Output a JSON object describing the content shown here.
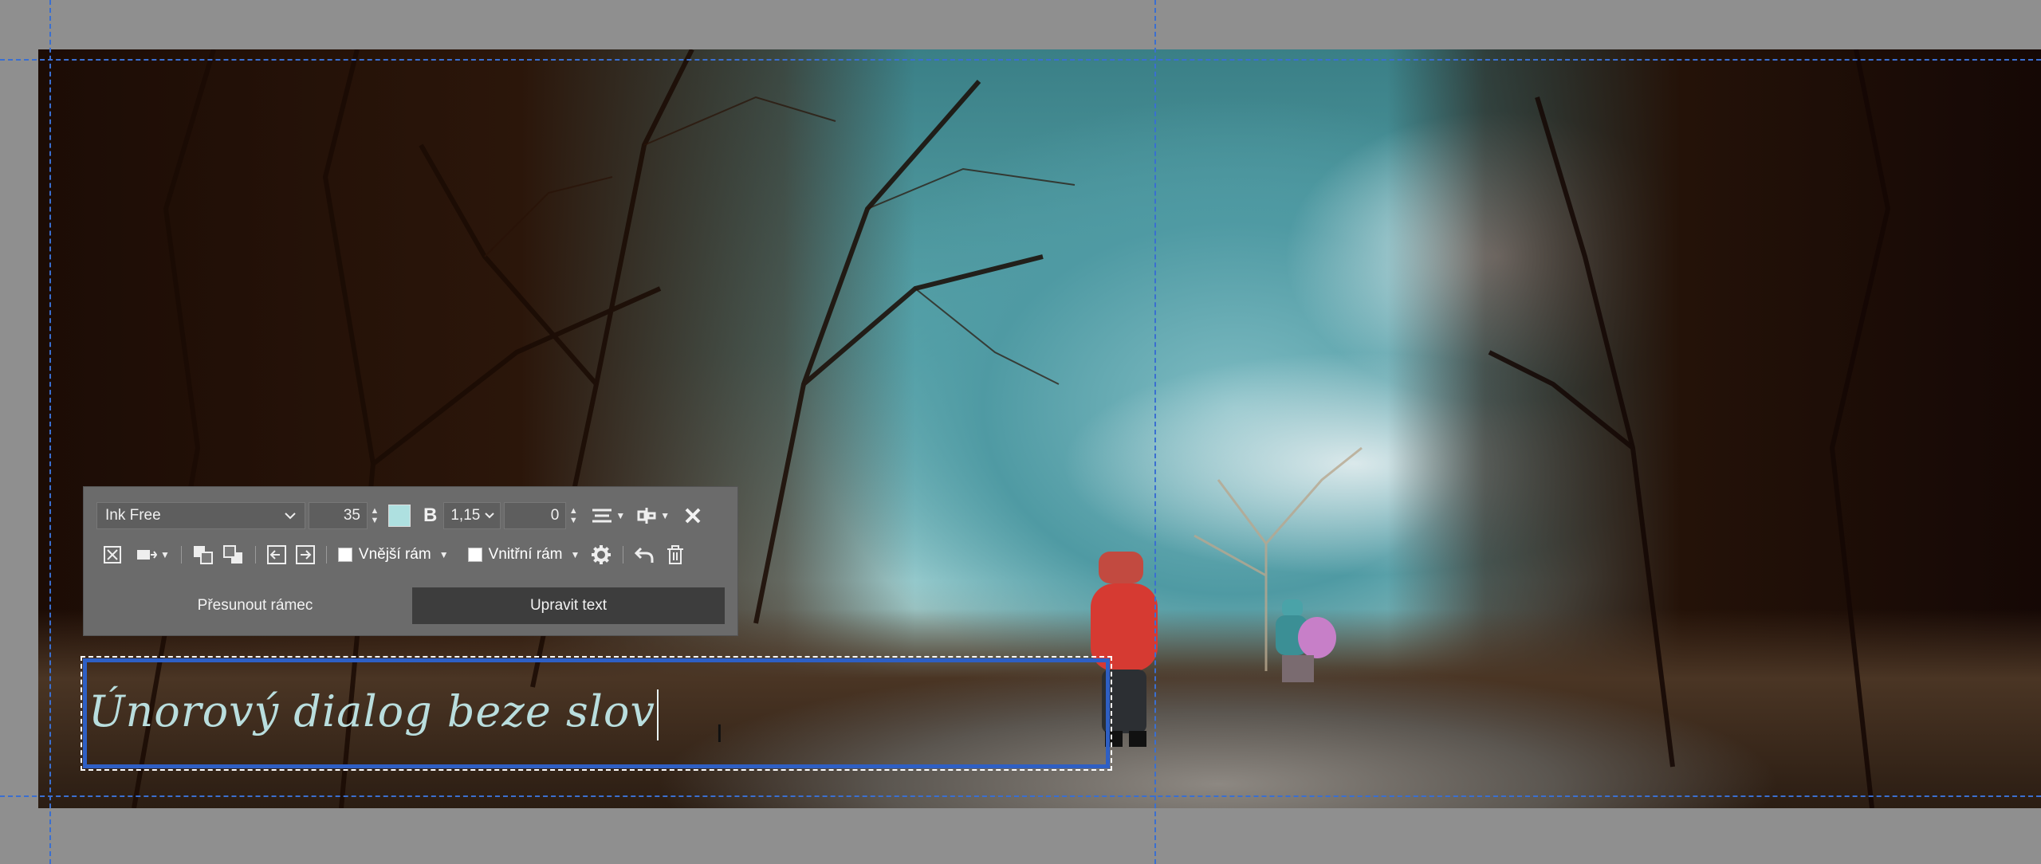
{
  "colors": {
    "guide": "#3a6fd1",
    "toolbar_bg": "#6b6b6b",
    "text_color_swatch": "#aee0e0",
    "frame_border": "#2e5fc4"
  },
  "toolbar": {
    "font_family": "Ink Free",
    "font_size": "35",
    "bold_label": "B",
    "line_spacing": "1,15",
    "letter_spacing": "0",
    "outer_frame_label": "Vnější rám",
    "inner_frame_label": "Vnitřní rám",
    "move_frame_label": "Přesunout rámec",
    "edit_text_label": "Upravit text",
    "icons": [
      "chevron-down-icon",
      "spin-up-icon",
      "spin-down-icon",
      "align-icon",
      "text-position-icon",
      "close-icon",
      "fit-frame-icon",
      "wrap-icon",
      "bring-forward-icon",
      "send-backward-icon",
      "indent-left-icon",
      "indent-right-icon",
      "settings-icon",
      "undo-icon",
      "delete-icon"
    ]
  },
  "text_frame": {
    "content": "Únorový dialog beze slov"
  }
}
